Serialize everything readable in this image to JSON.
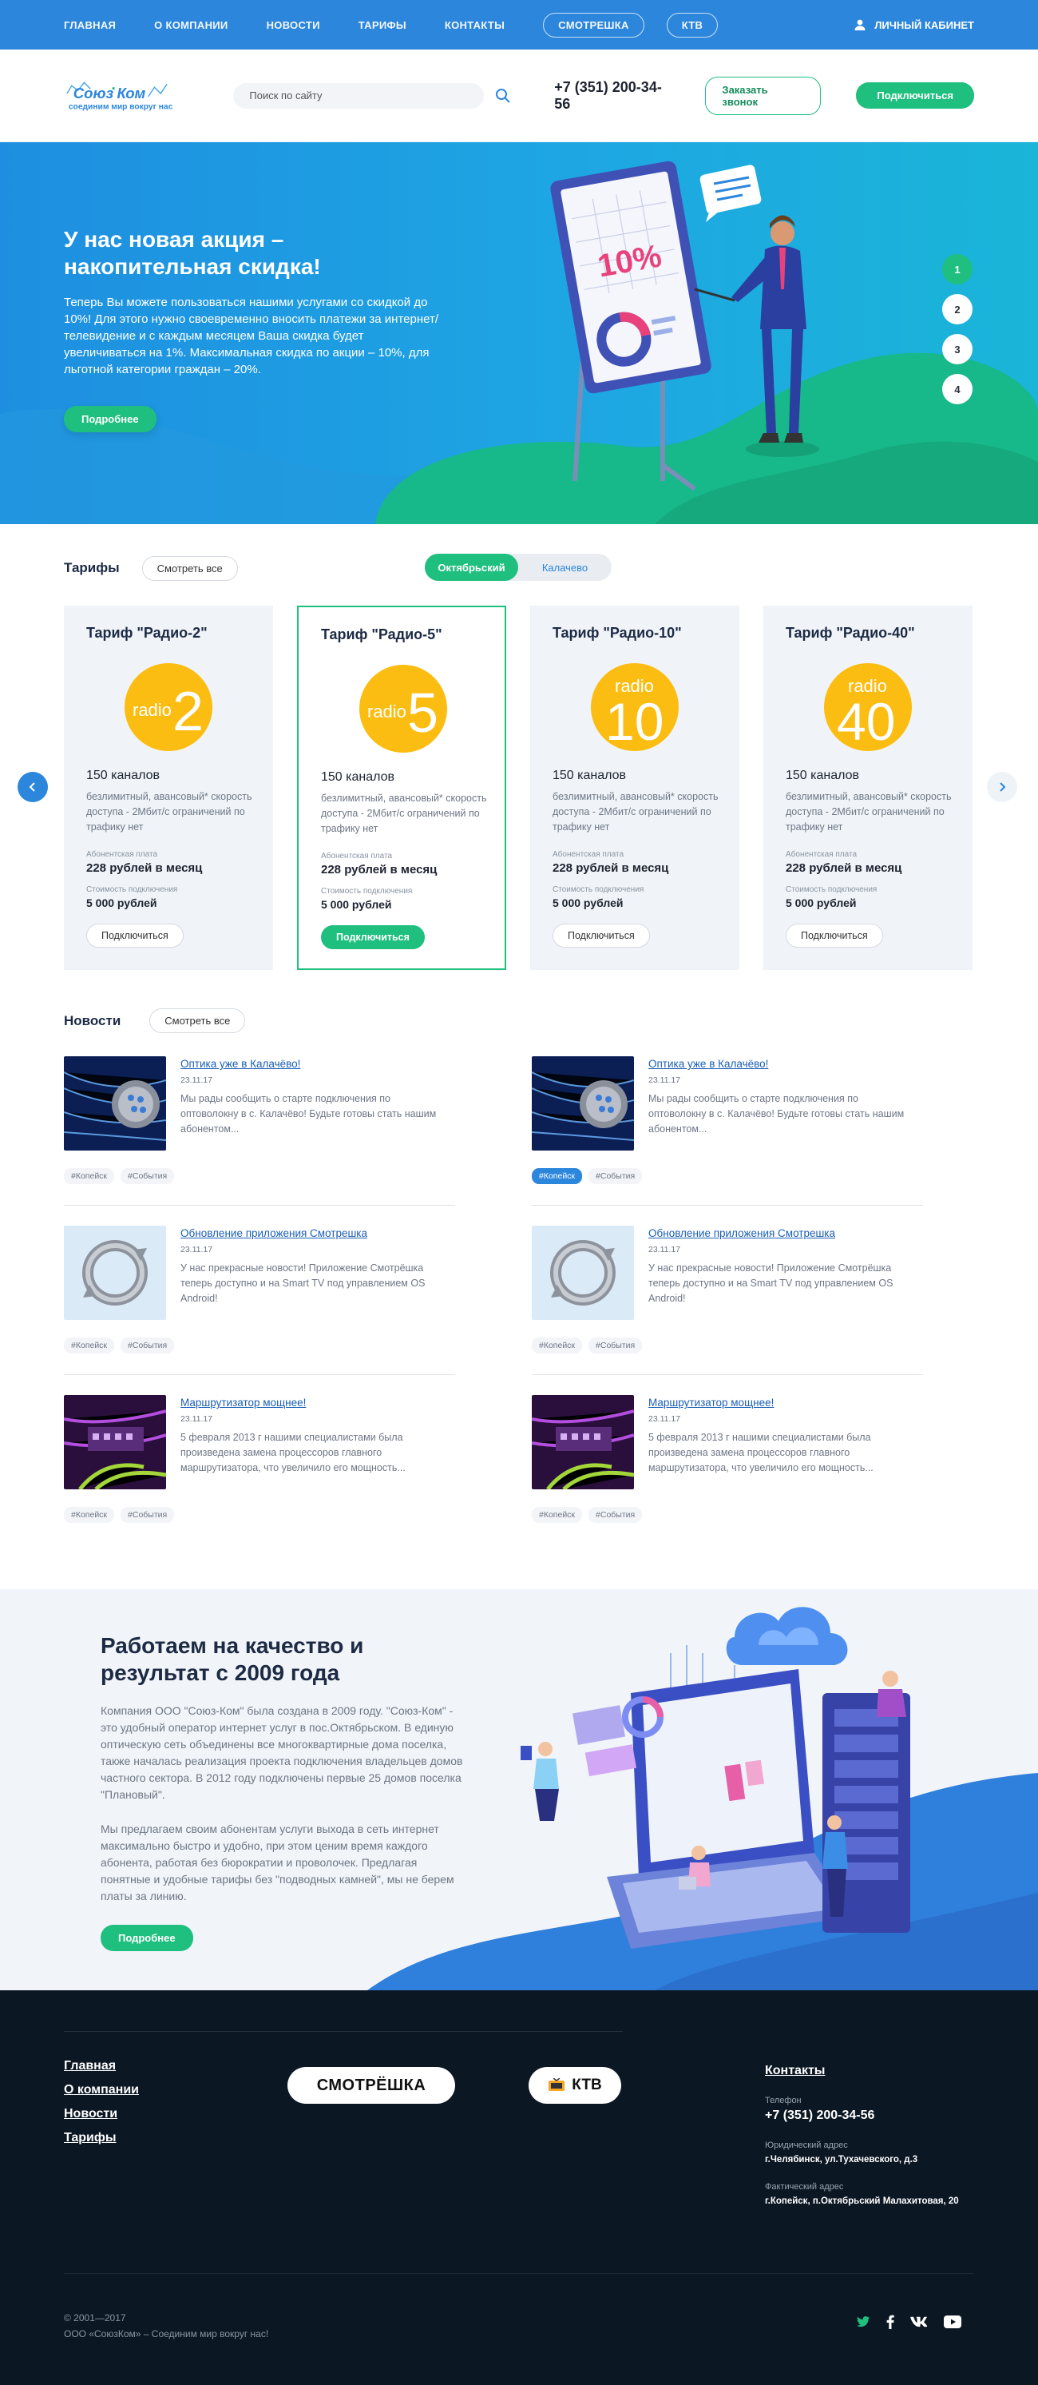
{
  "topbar": {
    "nav": [
      "ГЛАВНАЯ",
      "О КОМПАНИИ",
      "НОВОСТИ",
      "ТАРИФЫ",
      "КОНТАКТЫ"
    ],
    "pill1": "СМОТРЕШКА",
    "pill2": "КТВ",
    "cabinet": "ЛИЧНЫЙ КАБИНЕТ",
    "bg": "#2c86dc"
  },
  "header": {
    "logo_main": "СоюзКом",
    "logo_tagline": "соединим мир вокруг нас",
    "search_placeholder": "Поиск по сайту",
    "phone": "+7 (351) 200-34-56",
    "callback": "Заказать звонок",
    "connect": "Подключиться"
  },
  "hero": {
    "title": "У нас новая акция – накопительная скидка!",
    "text": "Теперь Вы можете пользоваться нашими услугами со скидкой до 10%! Для этого нужно своевременно вносить платежи за интернет/телевидение и с каждым месяцем Ваша скидка будет увеличиваться на 1%. Максимальная скидка по акции – 10%, для льготной категории граждан – 20%.",
    "more": "Подробнее",
    "illustration_text": "10%",
    "slides": [
      "1",
      "2",
      "3",
      "4"
    ]
  },
  "tariffs": {
    "title": "Тарифы",
    "see_all": "Смотреть все",
    "locations": [
      "Октябрьский",
      "Калачево"
    ],
    "cards": [
      {
        "name": "Тариф \"Радио-2\"",
        "badge_word": "radio",
        "badge_num": "2",
        "channels": "150 каналов",
        "desc": "безлимитный, авансовый* скорость доступа - 2Мбит/с ограничений по трафику нет",
        "fee_label": "Абонентская плата",
        "fee": "228 рублей в месяц",
        "conn_label": "Стоимость подключения",
        "conn": "5 000 рублей",
        "button": "Подключиться"
      },
      {
        "name": "Тариф \"Радио-5\"",
        "badge_word": "radio",
        "badge_num": "5",
        "channels": "150 каналов",
        "desc": "безлимитный, авансовый* скорость доступа - 2Мбит/с ограничений по трафику нет",
        "fee_label": "Абонентская плата",
        "fee": "228 рублей в месяц",
        "conn_label": "Стоимость подключения",
        "conn": "5 000 рублей",
        "button": "Подключиться"
      },
      {
        "name": "Тариф \"Радио-10\"",
        "badge_word": "radio",
        "badge_num": "10",
        "channels": "150 каналов",
        "desc": "безлимитный, авансовый* скорость доступа - 2Мбит/с ограничений по трафику нет",
        "fee_label": "Абонентская плата",
        "fee": "228 рублей в месяц",
        "conn_label": "Стоимость подключения",
        "conn": "5 000 рублей",
        "button": "Подключиться"
      },
      {
        "name": "Тариф \"Радио-40\"",
        "badge_word": "radio",
        "badge_num": "40",
        "channels": "150 каналов",
        "desc": "безлимитный, авансовый* скорость доступа - 2Мбит/с ограничений по трафику нет",
        "fee_label": "Абонентская плата",
        "fee": "228 рублей в месяц",
        "conn_label": "Стоимость подключения",
        "conn": "5 000 рублей",
        "button": "Подключиться"
      }
    ]
  },
  "news": {
    "title": "Новости",
    "see_all": "Смотреть все",
    "items": [
      {
        "title": "Оптика уже в Калачёво!",
        "date": "23.11.17",
        "text": "Мы рады сообщить о старте подключения по оптоволокну в с. Калачёво! Будьте готовы стать нашим абонентом...",
        "tags": [
          "#Копейск",
          "#События"
        ]
      },
      {
        "title": "Оптика уже в Калачёво!",
        "date": "23.11.17",
        "text": "Мы рады сообщить о старте подключения по оптоволокну в с. Калачёво! Будьте готовы стать нашим абонентом...",
        "tags": [
          "#Копейск",
          "#События"
        ]
      },
      {
        "title": "Обновление приложения Смотрешка",
        "date": "23.11.17",
        "text": "У нас прекрасные новости! Приложение Смотрёшка теперь доступно и на Smart TV под управлением OS Android!",
        "tags": [
          "#Копейск",
          "#События"
        ]
      },
      {
        "title": "Обновление приложения Смотрешка",
        "date": "23.11.17",
        "text": "У нас прекрасные новости! Приложение Смотрёшка теперь доступно и на Smart TV под управлением OS Android!",
        "tags": [
          "#Копейск",
          "#События"
        ]
      },
      {
        "title": "Маршрутизатор мощнее!",
        "date": "23.11.17",
        "text": "5 февраля 2013 г нашими специалистами была произведена замена процессоров главного маршрутизатора, что увеличило его мощность...",
        "tags": [
          "#Копейск",
          "#События"
        ]
      },
      {
        "title": "Маршрутизатор мощнее!",
        "date": "23.11.17",
        "text": "5 февраля 2013 г нашими специалистами была произведена замена процессоров главного маршрутизатора, что увеличило его мощность...",
        "tags": [
          "#Копейск",
          "#События"
        ]
      }
    ]
  },
  "about": {
    "title": "Работаем на качество и результат с 2009 года",
    "p1": "Компания ООО \"Союз-Ком\" была создана в 2009 году. \"Союз-Ком\" - это удобный оператор интернет услуг в пос.Октябрьском. В единую оптическую сеть объединены все многоквартирные дома поселка, также началась реализация проекта подключения владельцев домов частного сектора. В 2012 году подключены первые 25 домов  поселка \"Плановый\".",
    "p2": "Мы предлагаем своим абонентам услуги выхода в сеть интернет максимально быстро и удобно, при этом ценим время каждого абонента, работая без бюрократии и проволочек. Предлагая понятные и удобные тарифы без \"подводных камней\", мы не берем платы за линию.",
    "more": "Подробнее"
  },
  "footer": {
    "links": [
      "Главная",
      "О компании",
      "Новости",
      "Тарифы"
    ],
    "smotreshka": "СМОТРЁШКА",
    "ktv": "КТВ",
    "contacts_title": "Контакты",
    "phone_label": "Телефон",
    "phone": "+7 (351) 200-34-56",
    "legal_label": "Юридический адрес",
    "legal": "г.Челябинск, ул.Тухачевского, д.3",
    "fact_label": "Фактический адрес",
    "fact": "г.Копейск, п.Октябрьский Малахитовая, 20",
    "copy1": "© 2001—2017",
    "copy2": "ООО «СоюзКом» – Соединим мир вокруг нас!"
  }
}
